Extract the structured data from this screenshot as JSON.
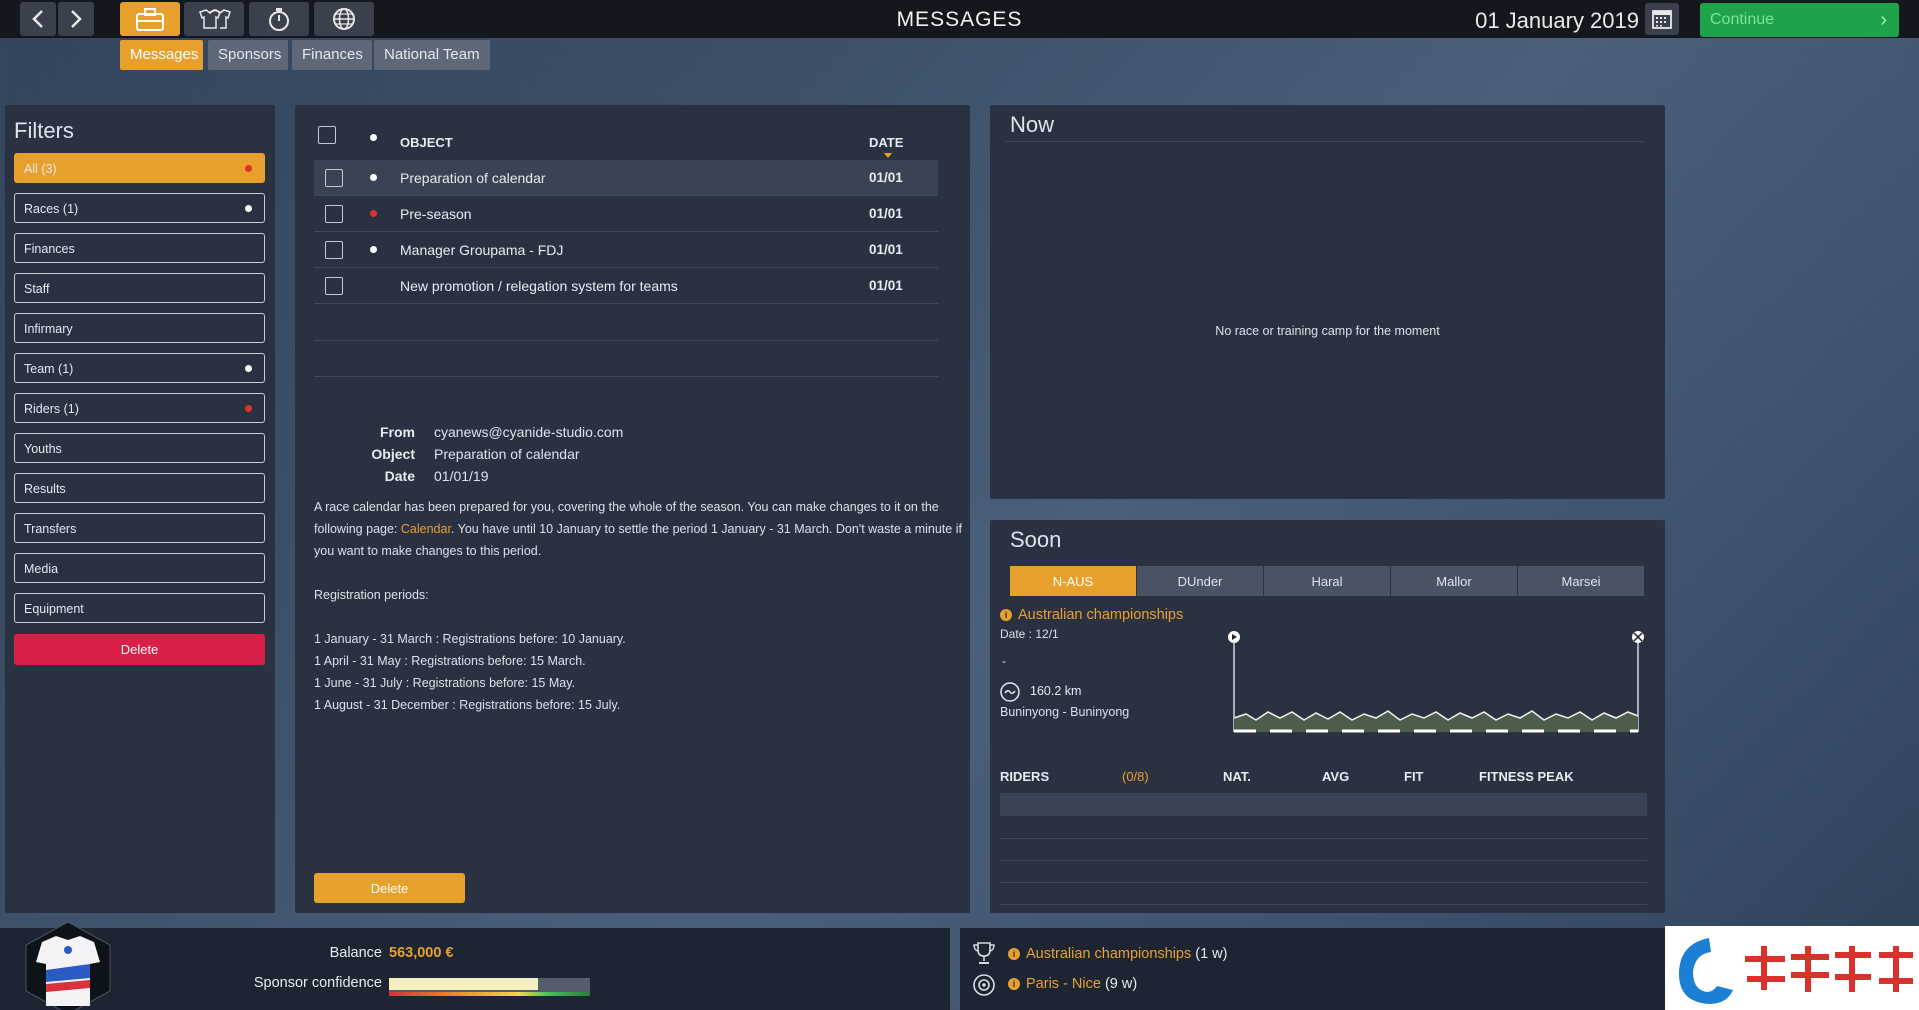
{
  "topbar": {
    "title": "MESSAGES",
    "date": "01 January 2019",
    "continue_label": "Continue"
  },
  "subtabs": [
    {
      "label": "Messages",
      "active": true
    },
    {
      "label": "Sponsors"
    },
    {
      "label": "Finances"
    },
    {
      "label": "National Team"
    }
  ],
  "filters": {
    "title": "Filters",
    "items": [
      {
        "label": "All (3)",
        "dot": "red",
        "active": true
      },
      {
        "label": "Races (1)",
        "dot": "white"
      },
      {
        "label": "Finances"
      },
      {
        "label": "Staff"
      },
      {
        "label": "Infirmary"
      },
      {
        "label": "Team (1)",
        "dot": "white"
      },
      {
        "label": "Riders (1)",
        "dot": "red"
      },
      {
        "label": "Youths"
      },
      {
        "label": "Results"
      },
      {
        "label": "Transfers"
      },
      {
        "label": "Media"
      },
      {
        "label": "Equipment"
      }
    ],
    "delete_label": "Delete"
  },
  "messages": {
    "header": {
      "object": "OBJECT",
      "date": "DATE"
    },
    "rows": [
      {
        "object": "Preparation of calendar",
        "date": "01/01",
        "dot": "white",
        "selected": true
      },
      {
        "object": "Pre-season",
        "date": "01/01",
        "dot": "red"
      },
      {
        "object": "Manager Groupama - FDJ",
        "date": "01/01",
        "dot": "white"
      },
      {
        "object": "New promotion / relegation system for teams",
        "date": "01/01",
        "dot": "none"
      }
    ],
    "detail": {
      "from_label": "From",
      "from": "cyanews@cyanide-studio.com",
      "object_label": "Object",
      "object": "Preparation of calendar",
      "date_label": "Date",
      "date": "01/01/19",
      "p1_a": "A race calendar has been prepared for you, covering the whole of the season. You can make changes to it on the following page: ",
      "p1_link": "Calendar",
      "p1_b": ". You have until 10 January to settle the period 1 January - 31 March. Don't waste a minute if you want to make changes to this period.",
      "reg_title": "Registration periods:",
      "reg_lines": [
        "1 January - 31 March : Registrations before: 10 January.",
        "1 April - 31 May : Registrations before: 15 March.",
        "1 June - 31 July : Registrations before: 15 May.",
        "1 August - 31 December : Registrations before: 15 July."
      ]
    },
    "delete_label": "Delete"
  },
  "now": {
    "title": "Now",
    "empty": "No race or training camp for the moment"
  },
  "soon": {
    "title": "Soon",
    "tabs": [
      {
        "label": "N-AUS",
        "active": true
      },
      {
        "label": "DUnder"
      },
      {
        "label": "Haral"
      },
      {
        "label": "Mallor"
      },
      {
        "label": "Marsei"
      }
    ],
    "race_name": "Australian championships",
    "race_date": "Date : 12/1",
    "dash": "-",
    "distance": "160.2 km",
    "route": "Buninyong - Buninyong",
    "riders_header": {
      "riders": "RIDERS",
      "count": "(0/8)",
      "nat": "NAT.",
      "avg": "AVG",
      "fit": "FIT",
      "peak": "FITNESS PEAK"
    }
  },
  "bottom": {
    "balance_label": "Balance",
    "balance": "563,000 €",
    "sponsor_label": "Sponsor confidence",
    "sponsor_confidence": 0.74,
    "upcoming": [
      {
        "name": "Australian championships",
        "when": "(1 w)"
      },
      {
        "name": "Paris - Nice",
        "when": "(9 w)"
      }
    ]
  },
  "colors": {
    "accent": "#e8a02c",
    "continue": "#1fa34a",
    "delete": "#d81f48"
  }
}
